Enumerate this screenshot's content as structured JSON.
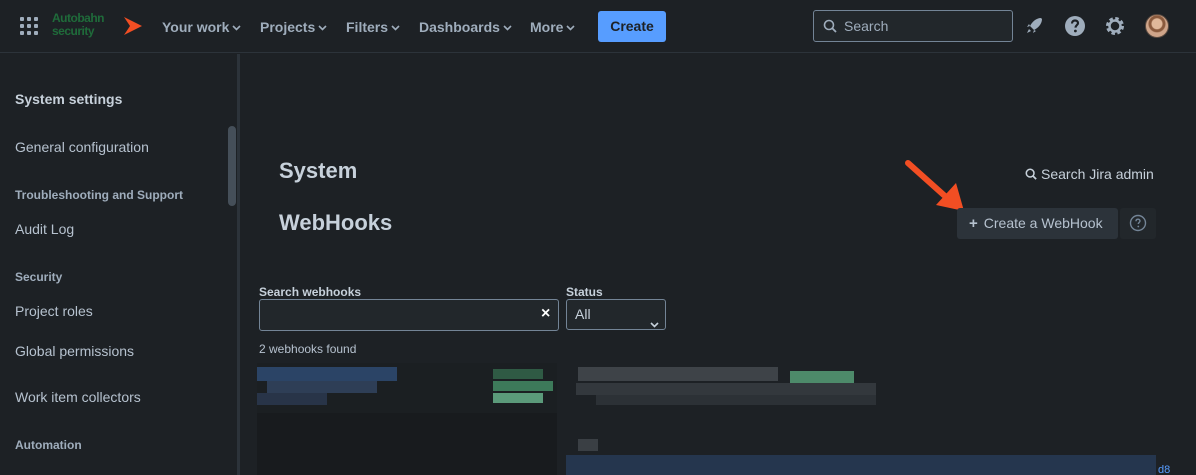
{
  "nav": {
    "logo_line1": "Autobahn",
    "logo_line2": "security",
    "items": [
      {
        "label": "Your work"
      },
      {
        "label": "Projects"
      },
      {
        "label": "Filters"
      },
      {
        "label": "Dashboards"
      },
      {
        "label": "More"
      }
    ],
    "create_label": "Create",
    "search_placeholder": "Search",
    "icons": [
      "app-switcher-icon",
      "rocket-icon",
      "help-icon",
      "gear-icon"
    ]
  },
  "sidebar": {
    "title": "System settings",
    "items": [
      {
        "type": "item",
        "label": "General configuration"
      },
      {
        "type": "heading",
        "label": "Troubleshooting and Support"
      },
      {
        "type": "item",
        "label": "Audit Log"
      },
      {
        "type": "heading",
        "label": "Security"
      },
      {
        "type": "item",
        "label": "Project roles"
      },
      {
        "type": "item",
        "label": "Global permissions"
      },
      {
        "type": "item",
        "label": "Work item collectors"
      },
      {
        "type": "heading",
        "label": "Automation"
      }
    ]
  },
  "main": {
    "title": "System",
    "subtitle": "WebHooks",
    "search_admin_label": "Search Jira admin",
    "create_webhook_label": "Create a WebHook",
    "search_label": "Search webhooks",
    "search_value": "",
    "clear_symbol": "×",
    "status_label": "Status",
    "status_value": "All",
    "found_text": "2 webhooks found",
    "link_fragment": "d8"
  },
  "colors": {
    "background": "#1d2125",
    "accent": "#579dff",
    "annotation_arrow": "#f24e23"
  }
}
